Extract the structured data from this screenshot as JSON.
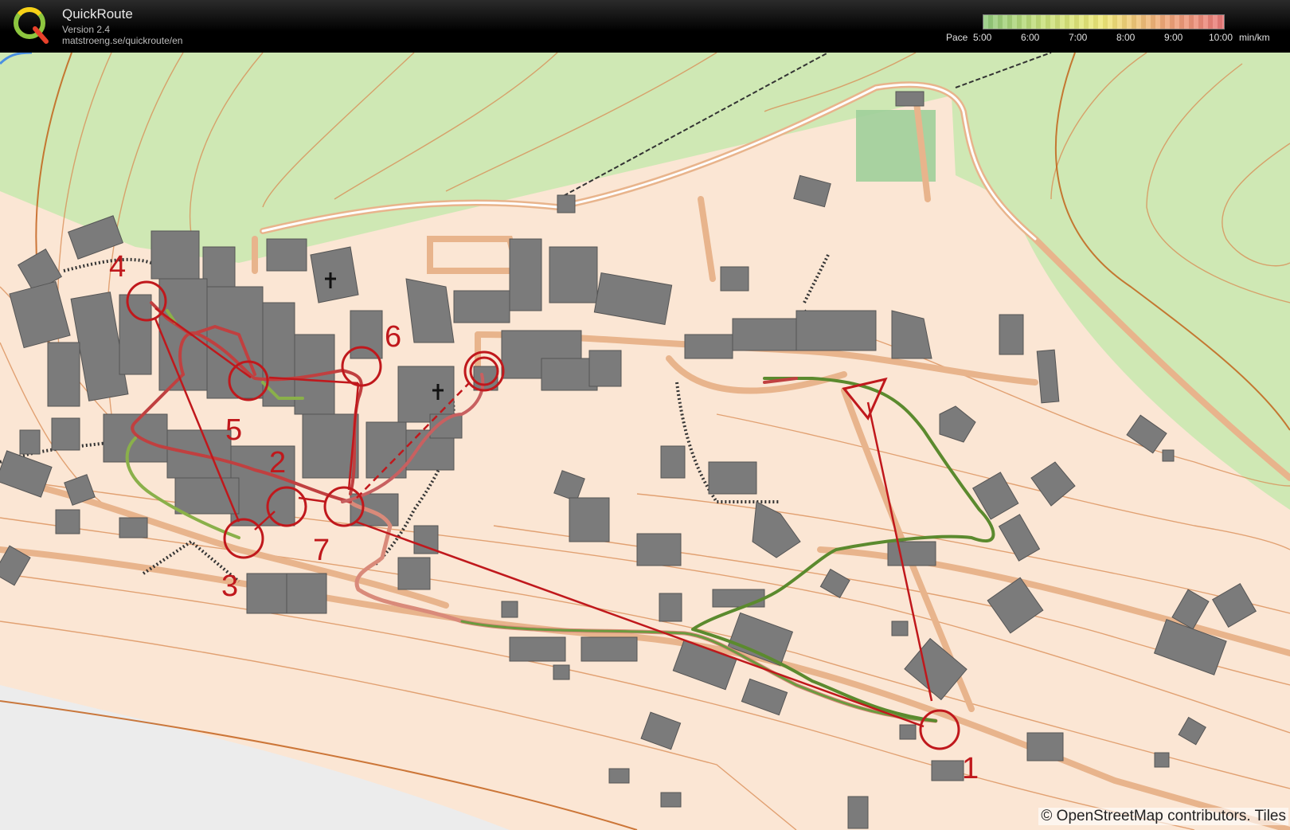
{
  "header": {
    "app_name": "QuickRoute",
    "version": "Version 2.4",
    "url": "matstroeng.se/quickroute/en",
    "pace_label": "Pace",
    "pace_ticks": [
      "5:00",
      "6:00",
      "7:00",
      "8:00",
      "9:00",
      "10:00"
    ],
    "pace_unit": "min/km",
    "pace_colors": [
      "#8fc87a",
      "#c8e07a",
      "#f0e878",
      "#f0a878",
      "#e87878"
    ]
  },
  "map": {
    "attribution": "© OpenStreetMap contributors. Tiles",
    "controls": [
      {
        "label": "1"
      },
      {
        "label": "2"
      },
      {
        "label": "3"
      },
      {
        "label": "4"
      },
      {
        "label": "5"
      },
      {
        "label": "6"
      },
      {
        "label": "7"
      }
    ],
    "course_color": "#c0181c",
    "forest_color": "#cfe8b4",
    "terrain_color": "#fbe6d4",
    "building_color": "#7a7a7a"
  }
}
